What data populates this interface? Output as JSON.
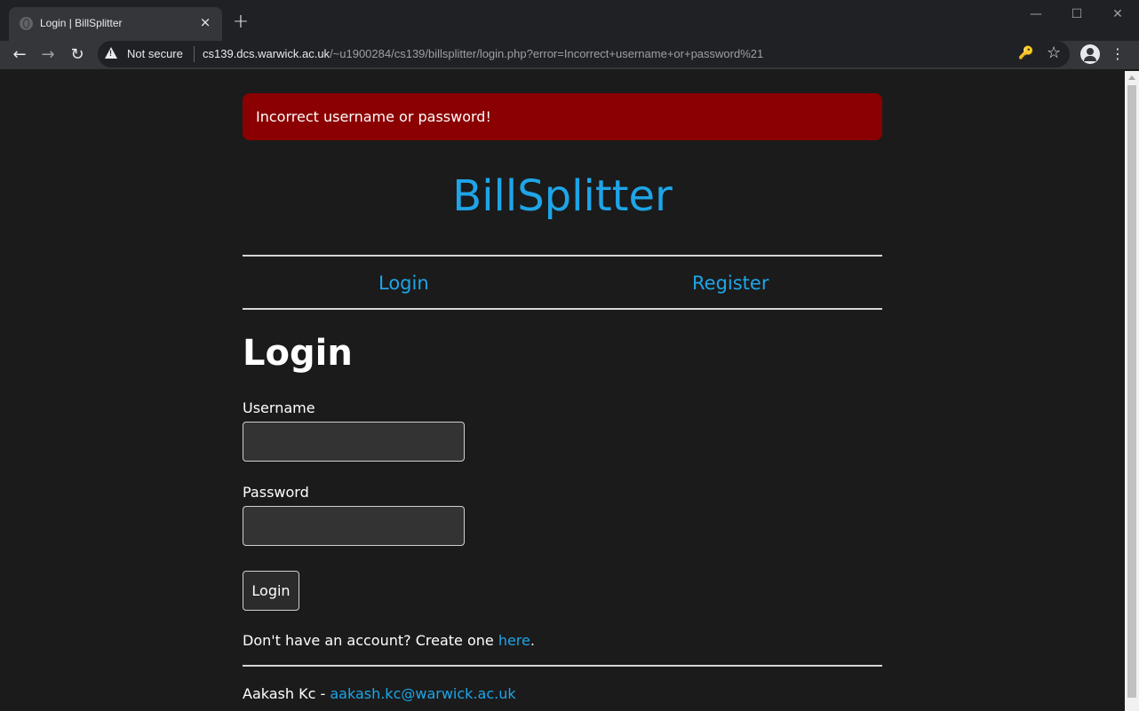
{
  "browser": {
    "tab_title": "Login | BillSplitter",
    "tab_close": "×",
    "new_tab": "+",
    "security_label": "Not secure",
    "url_host": "cs139.dcs.warwick.ac.uk",
    "url_path": "/~u1900284/cs139/billsplitter/login.php?error=Incorrect+username+or+password%21",
    "icons": {
      "back": "←",
      "forward": "→",
      "reload": "↻",
      "key": "🔑",
      "star": "☆",
      "menu": "⋮",
      "minimize": "—",
      "maximize": "☐",
      "close": "✕"
    }
  },
  "alert": {
    "message": "Incorrect username or password!"
  },
  "brand": {
    "title": "BillSplitter"
  },
  "nav": {
    "login": "Login",
    "register": "Register"
  },
  "form": {
    "heading": "Login",
    "username_label": "Username",
    "username_value": "",
    "password_label": "Password",
    "password_value": "",
    "submit_label": "Login"
  },
  "signup": {
    "prefix": "Don't have an account? Create one ",
    "link_text": "here",
    "suffix": "."
  },
  "footer": {
    "author": "Aakash Kc - ",
    "email": "aakash.kc@warwick.ac.uk"
  },
  "colors": {
    "accent": "#1ea5e8",
    "alert_bg": "#8b0000",
    "page_bg": "#1b1b1b"
  }
}
